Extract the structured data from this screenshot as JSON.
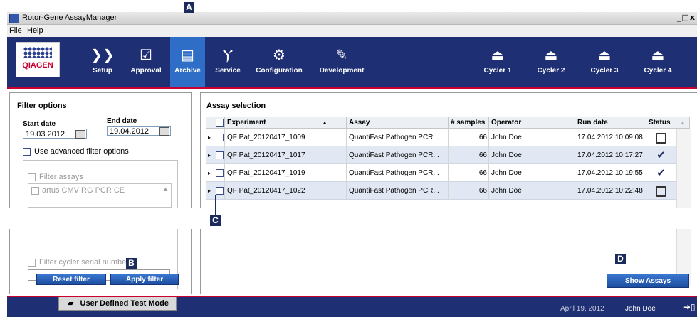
{
  "window": {
    "title": "Rotor-Gene AssayManager",
    "controls": "_□x"
  },
  "menu": [
    "File",
    "Help"
  ],
  "brand": "QIAGEN",
  "nav": {
    "items": [
      {
        "label": "Setup",
        "icon": "setup-icon"
      },
      {
        "label": "Approval",
        "icon": "approval-icon"
      },
      {
        "label": "Archive",
        "icon": "archive-icon",
        "active": true
      },
      {
        "label": "Service",
        "icon": "service-icon"
      },
      {
        "label": "Configuration",
        "icon": "configuration-icon"
      },
      {
        "label": "Development",
        "icon": "development-icon"
      }
    ],
    "cyclers": [
      "Cycler 1",
      "Cycler 2",
      "Cycler 3",
      "Cycler 4"
    ]
  },
  "callouts": {
    "a": "A",
    "b": "B",
    "c": "C",
    "d": "D"
  },
  "filter": {
    "title": "Filter options",
    "start_label": "Start date",
    "start_value": "19.03.2012",
    "end_label": "End date",
    "end_value": "19.04.2012",
    "advanced_label": "Use advanced filter options",
    "filter_assays_label": "Filter assays",
    "assay_option": "artus CMV RG PCR CE",
    "filter_cycler_label": "Filter cycler serial number",
    "reset_label": "Reset filter",
    "apply_label": "Apply filter"
  },
  "assays": {
    "title": "Assay selection",
    "columns": [
      "Experiment",
      "Assay",
      "# samples",
      "Operator",
      "Run date",
      "Status"
    ],
    "rows": [
      {
        "experiment": "QF Pat_20120417_1009",
        "assay": "QuantiFast Pathogen PCR...",
        "samples": "66",
        "operator": "John Doe",
        "run_date": "17.04.2012 10:09:08",
        "status": "open"
      },
      {
        "experiment": "QF Pat_20120417_1017",
        "assay": "QuantiFast Pathogen PCR...",
        "samples": "66",
        "operator": "John Doe",
        "run_date": "17.04.2012 10:17:27",
        "status": "checked"
      },
      {
        "experiment": "QF Pat_20120417_1019",
        "assay": "QuantiFast Pathogen PCR...",
        "samples": "66",
        "operator": "John Doe",
        "run_date": "17.04.2012 10:19:55",
        "status": "checked"
      },
      {
        "experiment": "QF Pat_20120417_1022",
        "assay": "QuantiFast Pathogen PCR...",
        "samples": "66",
        "operator": "John Doe",
        "run_date": "17.04.2012 10:22:48",
        "status": "open"
      }
    ],
    "show_label": "Show Assays"
  },
  "status": {
    "mode": "User Defined Test Mode",
    "date": "April 19, 2012",
    "user": "John Doe"
  },
  "colors": {
    "nav_bg": "#1f2f73",
    "accent": "#c9002f",
    "active": "#2e6ec6"
  }
}
